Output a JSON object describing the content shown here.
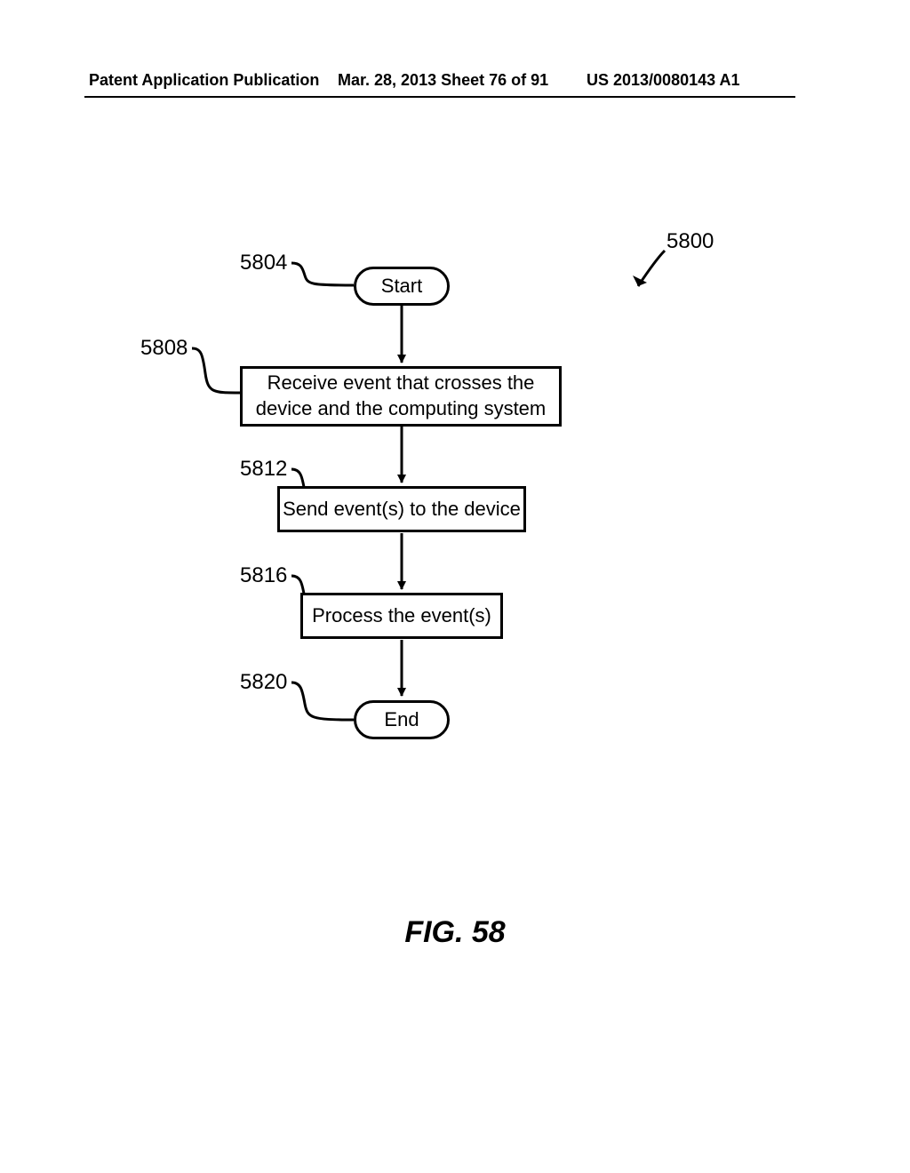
{
  "header": {
    "left": "Patent Application Publication",
    "center": "Mar. 28, 2013  Sheet 76 of 91",
    "right": "US 2013/0080143 A1"
  },
  "figure_label": "FIG. 58",
  "refs": {
    "overall": "5800",
    "start": "5804",
    "receive": "5808",
    "send": "5812",
    "process": "5816",
    "end": "5820"
  },
  "nodes": {
    "start": "Start",
    "receive": "Receive event that crosses the device and the computing system",
    "send": "Send event(s) to the device",
    "process": "Process the event(s)",
    "end": "End"
  }
}
